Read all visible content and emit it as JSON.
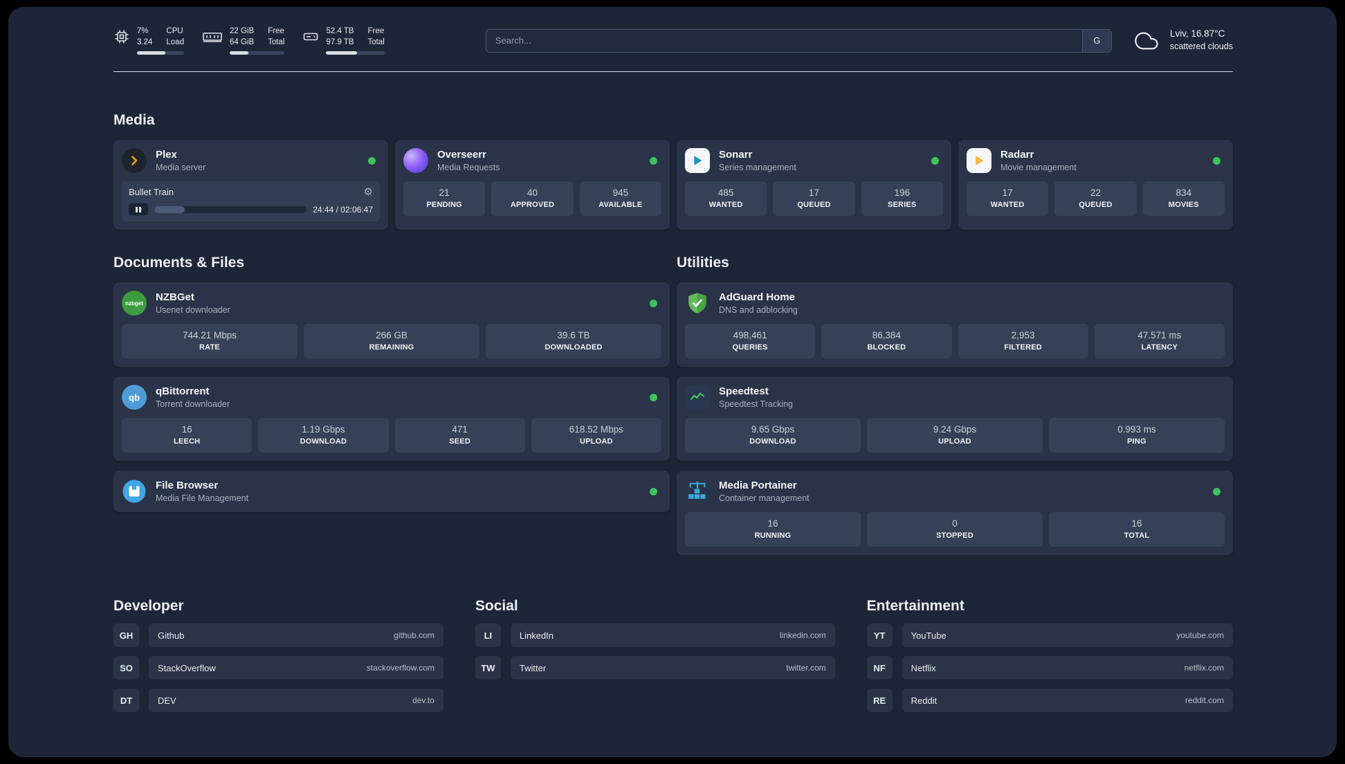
{
  "topbar": {
    "cpu": {
      "value": "7%",
      "sub": "3.24",
      "label_top": "CPU",
      "label_bottom": "Load",
      "progress": 60
    },
    "ram": {
      "value": "22 GiB",
      "sub": "64 GiB",
      "label_top": "Free",
      "label_bottom": "Total",
      "progress": 34
    },
    "disk": {
      "value": "52.4 TB",
      "sub": "97.9 TB",
      "label_top": "Free",
      "label_bottom": "Total",
      "progress": 53
    },
    "search": {
      "placeholder": "Search...",
      "engine_label": "G"
    },
    "weather": {
      "location": "Lviv, 16.87°C",
      "condition": "scattered clouds"
    }
  },
  "sections": {
    "media": "Media",
    "documents": "Documents & Files",
    "utilities": "Utilities",
    "developer": "Developer",
    "social": "Social",
    "entertainment": "Entertainment"
  },
  "apps": {
    "plex": {
      "name": "Plex",
      "subtitle": "Media server",
      "status": "online",
      "player": {
        "title": "Bullet Train",
        "time": "24:44 / 02:06:47",
        "progress": 20,
        "gear_glyph": "⚙"
      }
    },
    "overseerr": {
      "name": "Overseerr",
      "subtitle": "Media Requests",
      "status": "online",
      "stats": [
        {
          "value": "21",
          "label": "PENDING"
        },
        {
          "value": "40",
          "label": "APPROVED"
        },
        {
          "value": "945",
          "label": "AVAILABLE"
        }
      ]
    },
    "sonarr": {
      "name": "Sonarr",
      "subtitle": "Series management",
      "status": "online",
      "stats": [
        {
          "value": "485",
          "label": "WANTED"
        },
        {
          "value": "17",
          "label": "QUEUED"
        },
        {
          "value": "196",
          "label": "SERIES"
        }
      ]
    },
    "radarr": {
      "name": "Radarr",
      "subtitle": "Movie management",
      "status": "online",
      "stats": [
        {
          "value": "17",
          "label": "WANTED"
        },
        {
          "value": "22",
          "label": "QUEUED"
        },
        {
          "value": "834",
          "label": "MOVIES"
        }
      ]
    },
    "nzbget": {
      "name": "NZBGet",
      "subtitle": "Usenet downloader",
      "status": "online",
      "icon_label": "nzbget",
      "stats": [
        {
          "value": "744.21 Mbps",
          "label": "RATE"
        },
        {
          "value": "266 GB",
          "label": "REMAINING"
        },
        {
          "value": "39.6 TB",
          "label": "DOWNLOADED"
        }
      ]
    },
    "qbittorrent": {
      "name": "qBittorrent",
      "subtitle": "Torrent downloader",
      "status": "online",
      "icon_label": "qb",
      "stats": [
        {
          "value": "16",
          "label": "LEECH"
        },
        {
          "value": "1.19 Gbps",
          "label": "DOWNLOAD"
        },
        {
          "value": "471",
          "label": "SEED"
        },
        {
          "value": "618.52 Mbps",
          "label": "UPLOAD"
        }
      ]
    },
    "filebrowser": {
      "name": "File Browser",
      "subtitle": "Media File Management",
      "status": "online"
    },
    "adguard": {
      "name": "AdGuard Home",
      "subtitle": "DNS and adblocking",
      "stats": [
        {
          "value": "498,461",
          "label": "QUERIES"
        },
        {
          "value": "86,384",
          "label": "BLOCKED"
        },
        {
          "value": "2,953",
          "label": "FILTERED"
        },
        {
          "value": "47.571 ms",
          "label": "LATENCY"
        }
      ]
    },
    "speedtest": {
      "name": "Speedtest",
      "subtitle": "Speedtest Tracking",
      "stats": [
        {
          "value": "9.65 Gbps",
          "label": "DOWNLOAD"
        },
        {
          "value": "9.24 Gbps",
          "label": "UPLOAD"
        },
        {
          "value": "0.993 ms",
          "label": "PING"
        }
      ]
    },
    "portainer": {
      "name": "Media Portainer",
      "subtitle": "Container management",
      "status": "online",
      "stats": [
        {
          "value": "16",
          "label": "RUNNING"
        },
        {
          "value": "0",
          "label": "STOPPED"
        },
        {
          "value": "16",
          "label": "TOTAL"
        }
      ]
    }
  },
  "links": {
    "developer": [
      {
        "abbr": "GH",
        "name": "Github",
        "domain": "github.com"
      },
      {
        "abbr": "SO",
        "name": "StackOverflow",
        "domain": "stackoverflow.com"
      },
      {
        "abbr": "DT",
        "name": "DEV",
        "domain": "dev.to"
      }
    ],
    "social": [
      {
        "abbr": "LI",
        "name": "LinkedIn",
        "domain": "linkedin.com"
      },
      {
        "abbr": "TW",
        "name": "Twitter",
        "domain": "twitter.com"
      }
    ],
    "entertainment": [
      {
        "abbr": "YT",
        "name": "YouTube",
        "domain": "youtube.com"
      },
      {
        "abbr": "NF",
        "name": "Netflix",
        "domain": "netflix.com"
      },
      {
        "abbr": "RE",
        "name": "Reddit",
        "domain": "reddit.com"
      }
    ]
  },
  "colors": {
    "status_online": "#3ec35c",
    "page_bg": "#1d2637",
    "card_bg": "#2a3347",
    "tile_bg": "#364157"
  }
}
